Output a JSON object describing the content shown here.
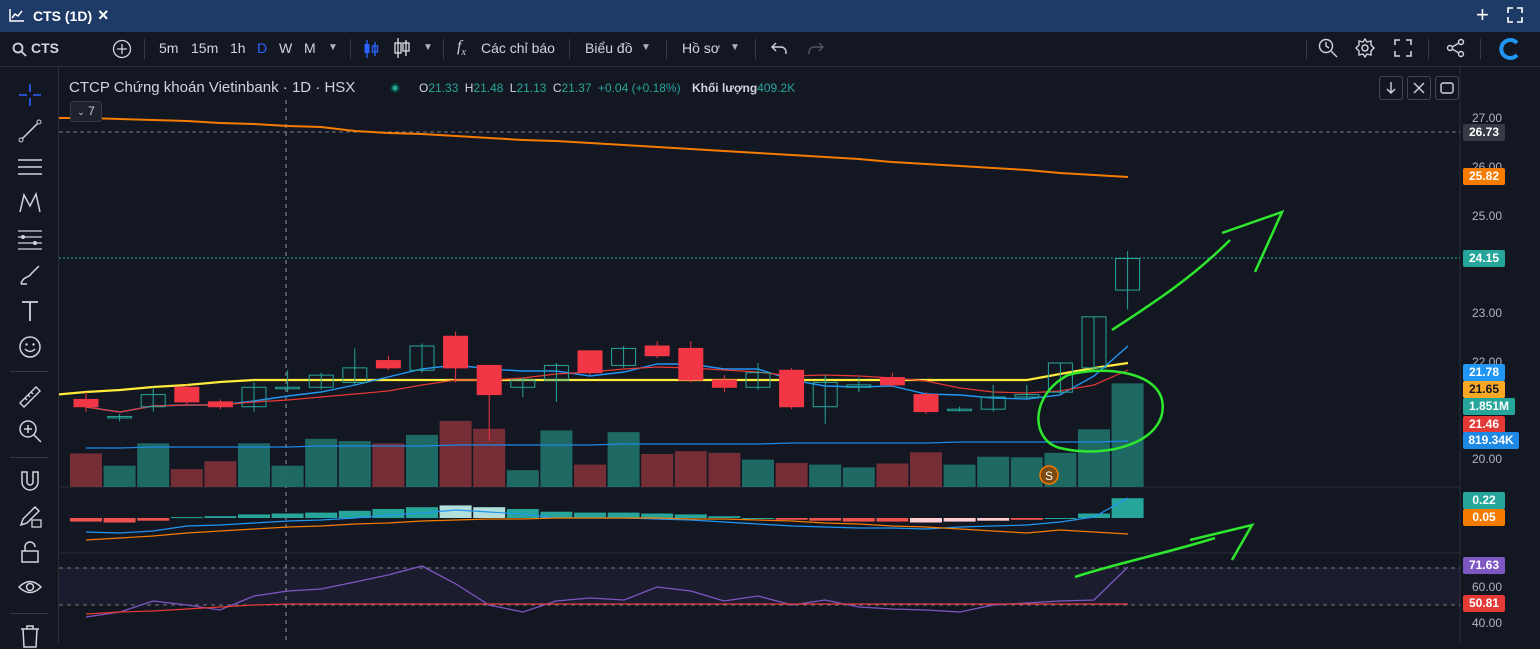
{
  "window": {
    "title": "CTS (1D)"
  },
  "toolbar": {
    "symbol": "CTS",
    "intervals": [
      "5m",
      "15m",
      "1h",
      "D",
      "W",
      "M"
    ],
    "active_interval": "D",
    "indicators_label": "Các chỉ báo",
    "chart_label": "Biểu đồ",
    "profile_label": "Hồ sơ"
  },
  "legend": {
    "name": "CTCP Chứng khoán Vietinbank · 1D · HSX",
    "o_label": "O",
    "o_value": "21.33",
    "h_label": "H",
    "h_value": "21.48",
    "l_label": "L",
    "l_value": "21.13",
    "c_label": "C",
    "c_value": "21.37",
    "change": "+0.04 (+0.18%)",
    "volume_label": "Khối lượng",
    "volume_value": "409.2K",
    "indicator_count": "7"
  },
  "axis": {
    "price_ticks": [
      "27.00",
      "26.00",
      "25.00",
      "23.00",
      "22.00",
      "20.00"
    ],
    "rsi_ticks": [
      "60.00",
      "40.00"
    ]
  },
  "price_tags": [
    {
      "value": "26.73",
      "color": "#363a45"
    },
    {
      "value": "25.82",
      "color": "#f57c00"
    },
    {
      "value": "24.15",
      "color": "#26a69a"
    },
    {
      "value": "21.78",
      "color": "#2196f3"
    },
    {
      "value": "21.65",
      "color": "#f9a825"
    },
    {
      "value": "1.851M",
      "color": "#26a69a"
    },
    {
      "value": "21.46",
      "color": "#e53935"
    },
    {
      "value": "819.34K",
      "color": "#1e88e5"
    },
    {
      "value": "0.22",
      "color": "#26a69a"
    },
    {
      "value": "0.05",
      "color": "#f57c00"
    },
    {
      "value": "71.63",
      "color": "#7e57c2"
    },
    {
      "value": "50.81",
      "color": "#e53935"
    }
  ],
  "colors": {
    "up": "#26a69a",
    "down": "#f23645",
    "accent": "#2962ff",
    "annotation": "#2ee82e"
  },
  "icons": [
    "crosshair-icon",
    "trendline-icon",
    "fib-icon",
    "pattern-icon",
    "measure-lines-icon",
    "brush-icon",
    "text-icon",
    "emoji-icon",
    "ruler-icon",
    "zoom-in-icon",
    "magnet-icon",
    "lock-pencil-icon",
    "lock-icon",
    "eye-icon",
    "trash-icon"
  ],
  "chart_data": {
    "type": "candlestick",
    "candles": [
      {
        "o": 21.25,
        "c": 21.1,
        "h": 21.4,
        "l": 21.0
      },
      {
        "o": 20.9,
        "c": 20.9,
        "h": 20.95,
        "l": 20.8
      },
      {
        "o": 21.1,
        "c": 21.35,
        "h": 21.5,
        "l": 21.0
      },
      {
        "o": 21.5,
        "c": 21.2,
        "h": 21.55,
        "l": 21.15
      },
      {
        "o": 21.2,
        "c": 21.1,
        "h": 21.25,
        "l": 21.05
      },
      {
        "o": 21.1,
        "c": 21.5,
        "h": 21.6,
        "l": 21.0
      },
      {
        "o": 21.5,
        "c": 21.5,
        "h": 21.85,
        "l": 21.4
      },
      {
        "o": 21.5,
        "c": 21.75,
        "h": 21.8,
        "l": 21.45
      },
      {
        "o": 21.6,
        "c": 21.9,
        "h": 22.3,
        "l": 21.55
      },
      {
        "o": 22.05,
        "c": 21.9,
        "h": 22.15,
        "l": 21.85
      },
      {
        "o": 21.85,
        "c": 22.35,
        "h": 22.4,
        "l": 21.8
      },
      {
        "o": 22.55,
        "c": 21.9,
        "h": 22.65,
        "l": 21.6
      },
      {
        "o": 21.95,
        "c": 21.35,
        "h": 21.95,
        "l": 20.4
      },
      {
        "o": 21.5,
        "c": 21.65,
        "h": 21.7,
        "l": 21.3
      },
      {
        "o": 21.65,
        "c": 21.95,
        "h": 22.0,
        "l": 21.2
      },
      {
        "o": 22.25,
        "c": 21.8,
        "h": 22.25,
        "l": 21.75
      },
      {
        "o": 21.95,
        "c": 22.3,
        "h": 22.35,
        "l": 21.9
      },
      {
        "o": 22.35,
        "c": 22.15,
        "h": 22.45,
        "l": 22.1
      },
      {
        "o": 22.3,
        "c": 21.65,
        "h": 22.45,
        "l": 21.6
      },
      {
        "o": 21.65,
        "c": 21.5,
        "h": 21.75,
        "l": 21.4
      },
      {
        "o": 21.5,
        "c": 21.8,
        "h": 22.0,
        "l": 21.45
      },
      {
        "o": 21.85,
        "c": 21.1,
        "h": 21.9,
        "l": 21.05
      },
      {
        "o": 21.1,
        "c": 21.6,
        "h": 21.75,
        "l": 20.75
      },
      {
        "o": 21.5,
        "c": 21.55,
        "h": 21.7,
        "l": 21.4
      },
      {
        "o": 21.7,
        "c": 21.55,
        "h": 21.8,
        "l": 21.5
      },
      {
        "o": 21.35,
        "c": 21.0,
        "h": 21.4,
        "l": 20.95
      },
      {
        "o": 21.05,
        "c": 21.05,
        "h": 21.1,
        "l": 21.0
      },
      {
        "o": 21.05,
        "c": 21.3,
        "h": 21.55,
        "l": 21.0
      },
      {
        "o": 21.3,
        "c": 21.35,
        "h": 21.55,
        "l": 21.25
      },
      {
        "o": 21.4,
        "c": 22.0,
        "h": 22.0,
        "l": 21.35
      },
      {
        "o": 21.9,
        "c": 22.95,
        "h": 22.95,
        "l": 21.85
      },
      {
        "o": 23.5,
        "c": 24.15,
        "h": 24.3,
        "l": 23.1
      }
    ],
    "volumes": [
      0.6,
      0.38,
      0.78,
      0.32,
      0.46,
      0.78,
      0.38,
      0.86,
      0.82,
      0.78,
      0.93,
      1.18,
      1.04,
      0.3,
      1.01,
      0.4,
      0.98,
      0.59,
      0.64,
      0.61,
      0.49,
      0.43,
      0.4,
      0.35,
      0.42,
      0.62,
      0.4,
      0.54,
      0.53,
      0.61,
      1.03,
      1.85
    ],
    "volume_ma": 0.82,
    "ma_yellow": 21.65,
    "ma_orange_start": 27.0,
    "ma_orange_end": 25.82,
    "macd_hist": [
      -0.04,
      -0.05,
      -0.03,
      0.01,
      0.02,
      0.04,
      0.05,
      0.06,
      0.08,
      0.1,
      0.12,
      0.14,
      0.12,
      0.1,
      0.07,
      0.06,
      0.06,
      0.05,
      0.04,
      0.02,
      0.0,
      -0.02,
      -0.03,
      -0.04,
      -0.04,
      -0.05,
      -0.04,
      -0.03,
      -0.02,
      0.0,
      0.05,
      0.22
    ],
    "rsi": [
      43,
      46,
      52,
      50,
      47,
      55,
      58,
      59,
      63,
      67,
      72,
      62,
      50,
      46,
      52,
      54,
      53,
      60,
      58,
      52,
      55,
      50,
      53,
      49,
      48,
      47,
      46,
      50,
      51,
      52,
      53,
      71.63
    ],
    "rsi_ma": 50.81
  }
}
